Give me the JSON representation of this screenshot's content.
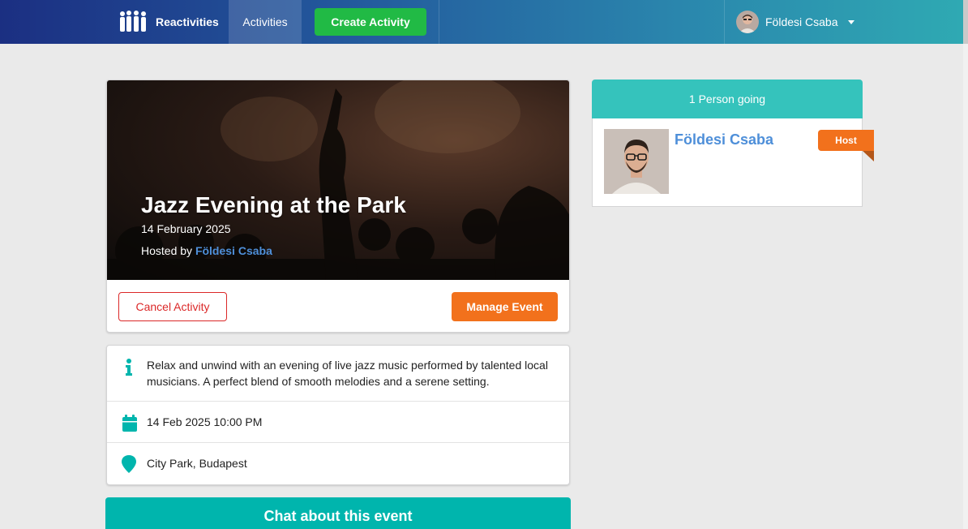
{
  "navbar": {
    "brand": "Reactivities",
    "activities": "Activities",
    "create_activity": "Create Activity",
    "user_name": "Földesi Csaba"
  },
  "activity": {
    "title": "Jazz Evening at the Park",
    "date": "14 February 2025",
    "hosted_by_prefix": "Hosted by ",
    "host_name": "Földesi Csaba",
    "cancel_label": "Cancel Activity",
    "manage_label": "Manage Event"
  },
  "details": {
    "description": "Relax and unwind with an evening of live jazz music performed by talented local musicians. A perfect blend of smooth melodies and a serene setting.",
    "datetime": "14 Feb 2025 10:00 PM",
    "location": "City Park, Budapest"
  },
  "chat": {
    "title": "Chat about this event"
  },
  "sidebar": {
    "header": "1 Person going",
    "attendees": [
      {
        "name": "Földesi Csaba",
        "badge": "Host"
      }
    ]
  },
  "colors": {
    "primary_teal": "#00b5ad",
    "orange": "#f2711c",
    "green": "#21ba45",
    "red": "#db2828",
    "link_blue": "#4e8fd9"
  }
}
